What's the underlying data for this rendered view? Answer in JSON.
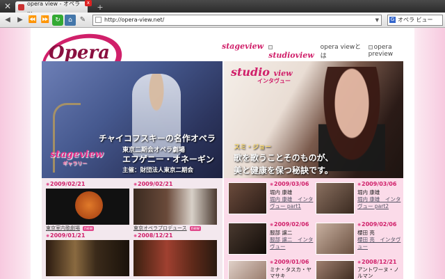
{
  "browser": {
    "tab_title": "opera view - オペラ ...",
    "close_label": "x",
    "new_tab_label": "+",
    "address": "http://opera-view.net/",
    "search_label": "オペラ ビュー"
  },
  "header": {
    "nav": [
      {
        "id": "stage",
        "label": "stageview"
      },
      {
        "id": "studio",
        "label": "studioview"
      },
      {
        "id": "about",
        "label": "opera viewとは"
      },
      {
        "id": "preview",
        "label": "opera preview"
      }
    ]
  },
  "hero_left": {
    "title": "チャイコフスキーの名作オペラ",
    "line2": "東京二期会オペラ劇場",
    "line3": "エフゲニー・オネーギン",
    "line4": "主催：財団法人東京二期会",
    "badge": "stageview",
    "badge_sub": "ギャラリー"
  },
  "hero_right": {
    "badge": "studio",
    "badge_v": "view",
    "badge_sub": "インタヴュー",
    "name": "スミ・ジョー",
    "quote1": "歌を歌うことそのものが、",
    "quote2": "美と健康を保つ秘訣です。"
  },
  "stage_items": [
    {
      "date": "2009/02/21",
      "caption": "東京室内歌劇場",
      "new": "new"
    },
    {
      "date": "2009/02/21",
      "caption": "東京オペラプロデュース",
      "new": "new"
    },
    {
      "date": "2009/01/21",
      "caption": "",
      "new": ""
    },
    {
      "date": "2008/12/21",
      "caption": "",
      "new": ""
    }
  ],
  "studio_items": [
    {
      "date": "2009/03/06",
      "name": "堀内 康雄",
      "link": "堀内 康雄　インタヴュー part1"
    },
    {
      "date": "2009/03/06",
      "name": "堀内 康雄",
      "link": "堀内 康雄　インタヴュー part2"
    },
    {
      "date": "2009/02/06",
      "name": "服部 譲二",
      "link": "服部 譲二　インタヴュー"
    },
    {
      "date": "2009/02/06",
      "name": "櫻田 亮",
      "link": "櫻田 亮　インタヴュー"
    },
    {
      "date": "2009/01/06",
      "name": "ミナ・タスカ・ヤマサキ",
      "link": ""
    },
    {
      "date": "2008/12/21",
      "name": "アントワーヌ・ノルマン",
      "link": ""
    }
  ]
}
